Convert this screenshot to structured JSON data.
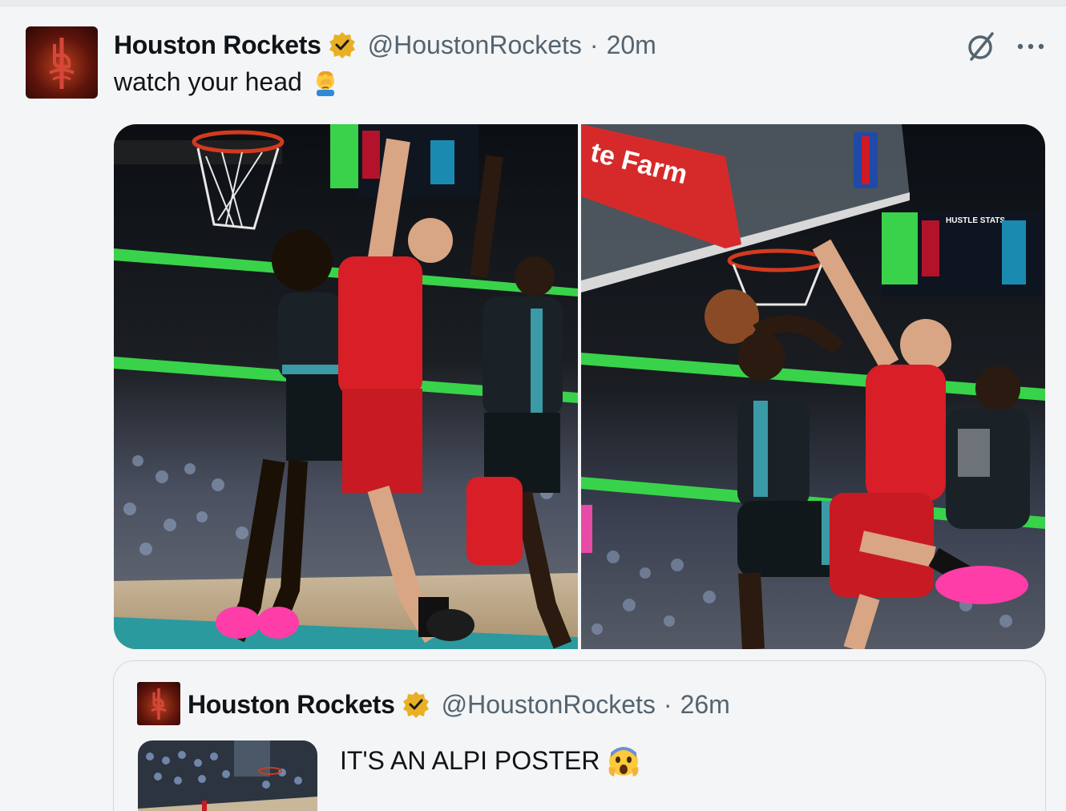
{
  "tweet": {
    "author_name": "Houston Rockets",
    "handle": "@HoustonRockets",
    "separator": "·",
    "time": "20m",
    "text": "watch your head",
    "text_emoji": "🤦",
    "verified": true,
    "verified_color": "#e8b025",
    "icons": {
      "grok": "grok-slash-icon",
      "more": "more-dots-icon",
      "avatar": "rockets-logo"
    },
    "media": [
      {
        "alt_visible_text": ""
      },
      {
        "scoreboard_text": "HUSTLE STATS",
        "banner_text": "te Farm"
      }
    ]
  },
  "quoted_tweet": {
    "author_name": "Houston Rockets",
    "handle": "@HoustonRockets",
    "separator": "·",
    "time": "26m",
    "text": "IT'S AN ALPI POSTER",
    "text_emoji": "😱",
    "verified": true
  },
  "colors": {
    "text_primary": "#0f1419",
    "text_secondary": "#536471",
    "background": "#f4f5f6",
    "border": "#cfd9de",
    "rockets_red": "#ce1a24",
    "grizzlies_teal": "#3a9aa6",
    "court_green": "#38d34a",
    "shoe_pink": "#ff3da8"
  }
}
